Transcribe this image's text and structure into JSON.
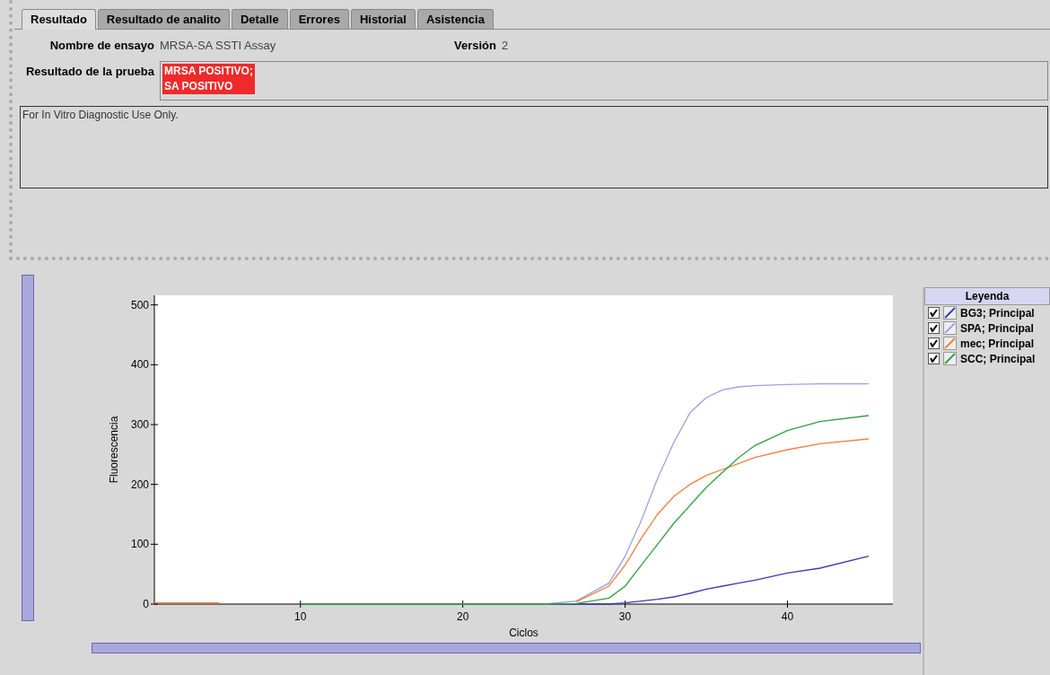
{
  "tabs": [
    {
      "label": "Resultado",
      "selected": true
    },
    {
      "label": "Resultado de analito",
      "selected": false
    },
    {
      "label": "Detalle",
      "selected": false
    },
    {
      "label": "Errores",
      "selected": false
    },
    {
      "label": "Historial",
      "selected": false
    },
    {
      "label": "Asistencia",
      "selected": false
    }
  ],
  "assay": {
    "label": "Nombre de ensayo",
    "value": "MRSA-SA SSTI Assay"
  },
  "version": {
    "label": "Versión",
    "value": "2"
  },
  "result": {
    "label": "Resultado de la prueba",
    "lines": [
      "MRSA POSITIVO;",
      "SA POSITIVO"
    ],
    "color": "#ee2a2a"
  },
  "notes": "For In Vitro Diagnostic Use Only.",
  "chart": {
    "chart_data": {
      "type": "line",
      "xlabel": "Ciclos",
      "ylabel": "Fluorescencia",
      "xlim": [
        1,
        46.5
      ],
      "ylim": [
        0,
        516
      ],
      "xticks": [
        10,
        20,
        30,
        40
      ],
      "yticks": [
        0,
        100,
        200,
        300,
        400,
        500
      ],
      "x": [
        1,
        5,
        10,
        15,
        20,
        25,
        27,
        29,
        30,
        31,
        32,
        33,
        34,
        35,
        36,
        37,
        38,
        40,
        42,
        45
      ],
      "series": [
        {
          "name": "BG3; Principal",
          "color": "#3a3ab8",
          "values": [
            null,
            null,
            null,
            null,
            null,
            0,
            0,
            0,
            2,
            5,
            8,
            12,
            18,
            25,
            30,
            35,
            40,
            52,
            60,
            80
          ]
        },
        {
          "name": "SPA; Principal",
          "color": "#a0a0e0",
          "values": [
            null,
            null,
            null,
            null,
            null,
            0,
            5,
            35,
            80,
            140,
            210,
            270,
            320,
            345,
            358,
            363,
            365,
            367,
            368,
            368
          ]
        },
        {
          "name": "mec; Principal",
          "color": "#f08040",
          "values": [
            2,
            2,
            null,
            null,
            null,
            null,
            4,
            30,
            65,
            110,
            150,
            180,
            200,
            215,
            225,
            235,
            245,
            258,
            268,
            276
          ]
        },
        {
          "name": "SCC; Principal",
          "color": "#30a040",
          "values": [
            null,
            null,
            0,
            0,
            0,
            0,
            1,
            10,
            30,
            65,
            100,
            135,
            165,
            195,
            220,
            245,
            265,
            290,
            305,
            315
          ]
        }
      ]
    }
  },
  "legend": {
    "title": "Leyenda",
    "items": [
      {
        "checked": true
      },
      {
        "checked": true
      },
      {
        "checked": true
      },
      {
        "checked": true
      }
    ]
  }
}
